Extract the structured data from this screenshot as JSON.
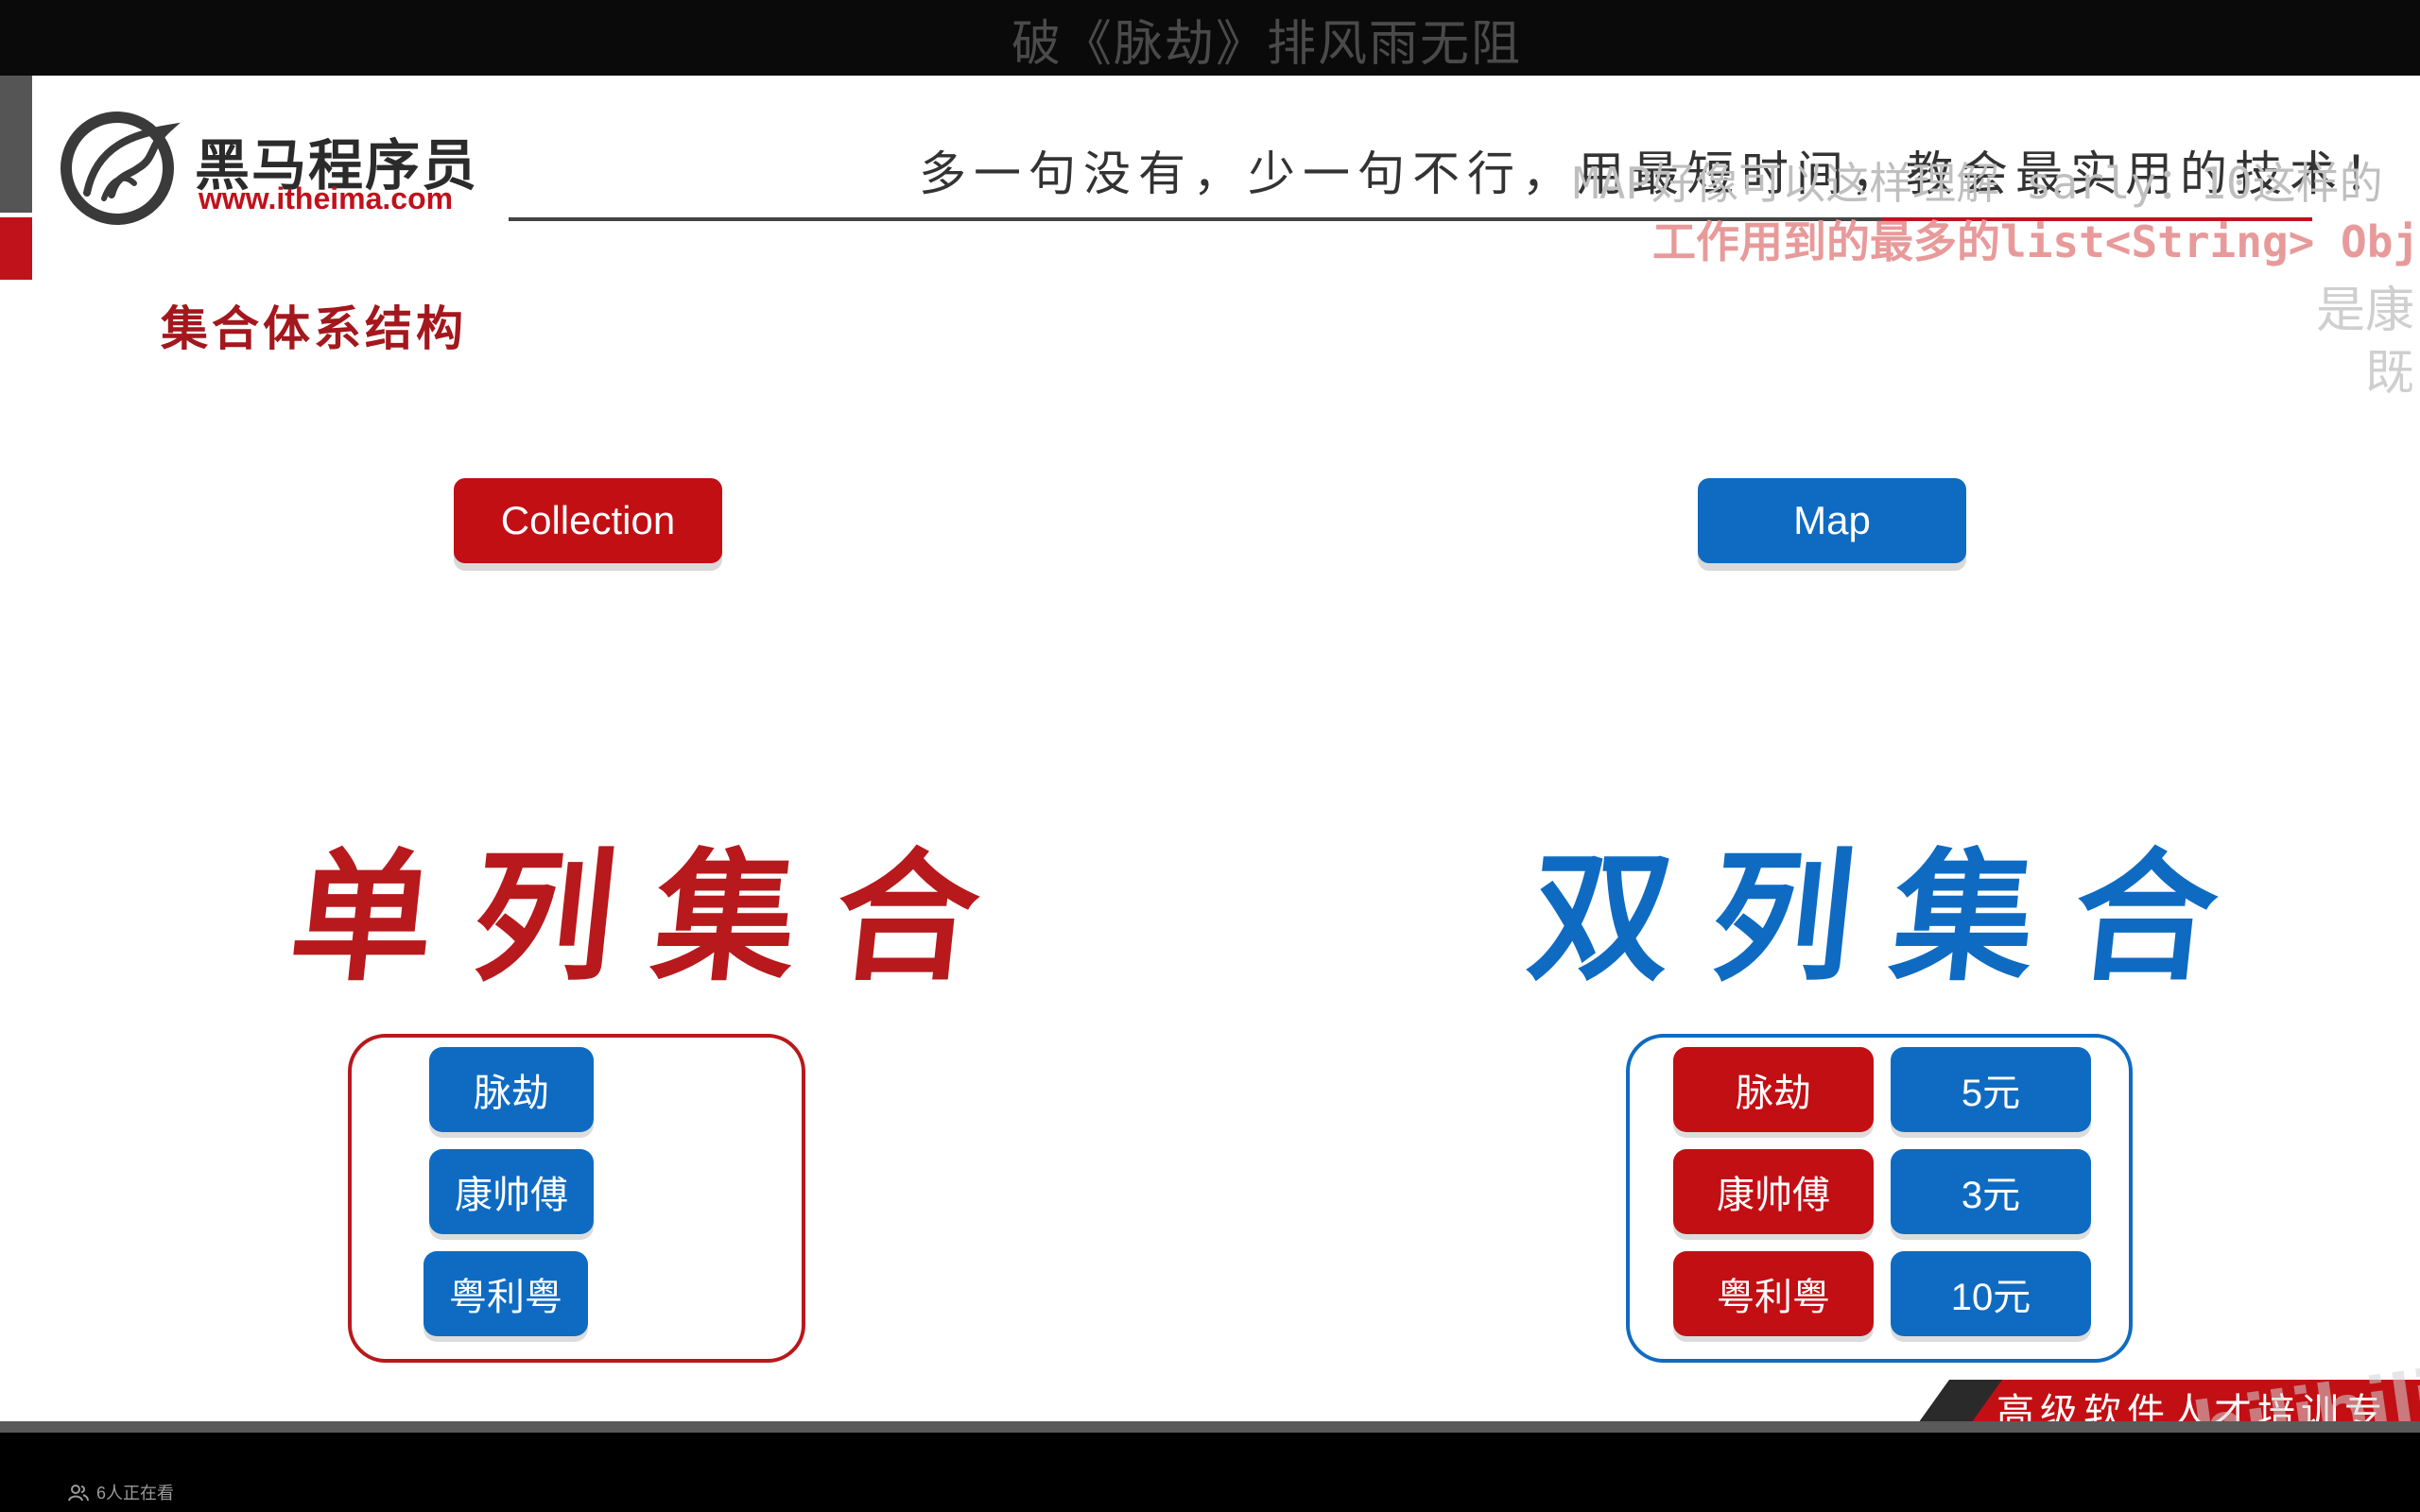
{
  "video": {
    "title": "破《脉劫》排风雨无阻",
    "viewers_text": "6人正在看"
  },
  "header": {
    "logo_cn": "黑马程序员",
    "logo_url": "www.itheima.com",
    "slogan": "多一句没有，少一句不行，用最短时间，教会最实用的技术！"
  },
  "slide": {
    "section_title": "集合体系结构",
    "collection_label": "Collection",
    "map_label": "Map",
    "single_column_label": "单列集合",
    "double_column_label": "双列集合",
    "single_items": [
      "脉劫",
      "康帅傅",
      "粤利粤"
    ],
    "double_items": [
      {
        "key": "脉劫",
        "value": "5元"
      },
      {
        "key": "康帅傅",
        "value": "3元"
      },
      {
        "key": "粤利粤",
        "value": "10元"
      }
    ],
    "banner": "高级软件人才培训专家"
  },
  "danmaku": {
    "line1": "MAP好像可以这样理解 sarly：10这样的",
    "line2": "工作用到的最多的list<String> Obj",
    "line3": "是康",
    "line4": "既"
  },
  "watermark": "bilibili",
  "colors": {
    "red": "#c20f14",
    "blue": "#0f6bc2",
    "dark_red_title": "#a3171d"
  }
}
